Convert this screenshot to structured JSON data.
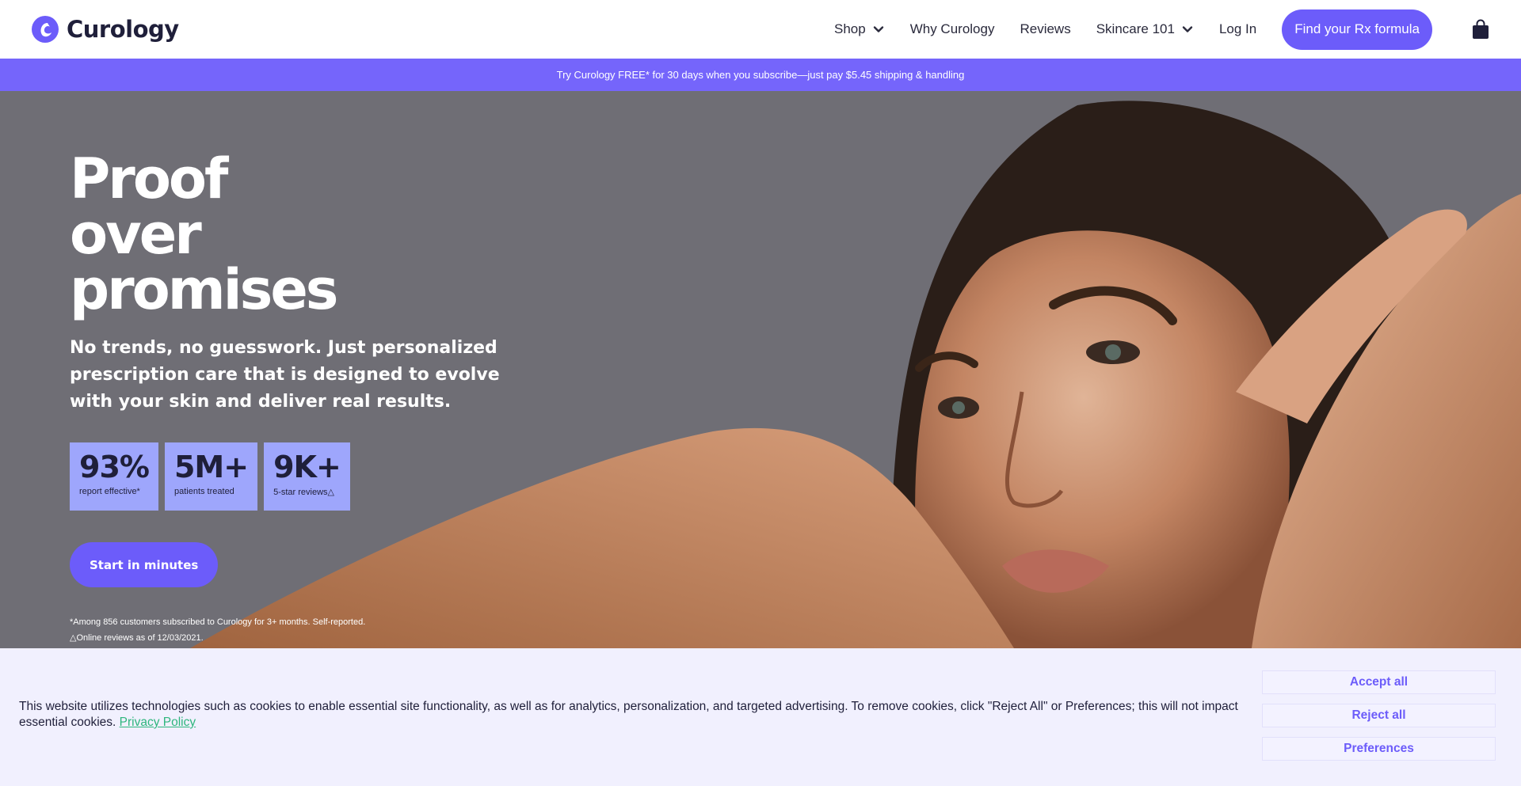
{
  "header": {
    "logo_text": "Curology",
    "brand_color": "#6c5cfa",
    "nav": {
      "shop": "Shop",
      "why": "Why Curology",
      "reviews": "Reviews",
      "skincare": "Skincare 101",
      "login": "Log In"
    },
    "cta": "Find your Rx formula",
    "cart_icon": "shopping-bag-icon"
  },
  "promo": {
    "text": "Try Curology FREE* for 30 days when you subscribe—just pay $5.45 shipping & handling",
    "bg_color": "#7565fb"
  },
  "hero": {
    "title": "Proof over promises",
    "subtitle": "No trends, no guesswork. Just personalized prescription care that is designed to evolve with your skin and deliver real results.",
    "stats": [
      {
        "value": "93%",
        "label": "report effective*"
      },
      {
        "value": "5M+",
        "label": "patients treated"
      },
      {
        "value": "9K+",
        "label": "5-star reviews△"
      }
    ],
    "stat_color": "#9ea6fc",
    "cta": "Start in minutes",
    "footnotes": [
      "*Among 856 customers subscribed to Curology for 3+ months. Self-reported.",
      "△Online reviews as of 12/03/2021."
    ]
  },
  "cookie": {
    "text": "This website utilizes technologies such as cookies to enable essential site functionality, as well as for analytics, personalization, and targeted advertising. To remove cookies, click \"Reject All\" or Preferences; this will not impact essential cookies.",
    "link": "Privacy Policy",
    "accept": "Accept all",
    "reject": "Reject all",
    "preferences": "Preferences"
  }
}
